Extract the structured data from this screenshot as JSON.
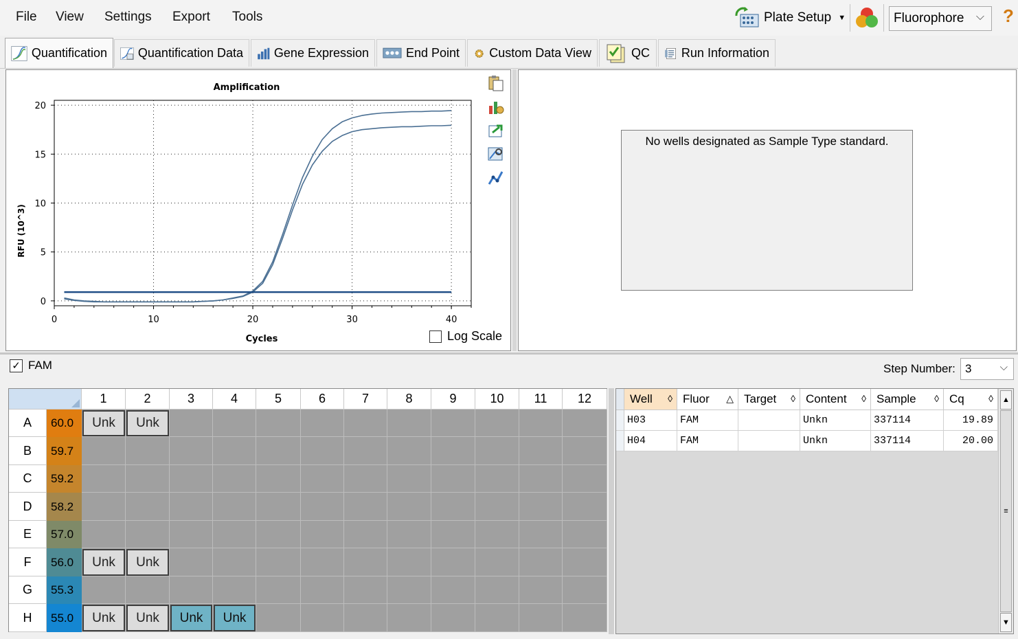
{
  "menu": {
    "items": [
      "File",
      "View",
      "Settings",
      "Export",
      "Tools"
    ]
  },
  "toolbar": {
    "plate_setup_label": "Plate Setup",
    "fluorophore_select": "Fluorophore",
    "help_label": "?"
  },
  "tabs": [
    {
      "label": "Quantification",
      "icon": "amplification-chart-icon",
      "active": true
    },
    {
      "label": "Quantification Data",
      "icon": "quantification-data-icon"
    },
    {
      "label": "Gene Expression",
      "icon": "bar-chart-icon"
    },
    {
      "label": "End Point",
      "icon": "end-point-icon"
    },
    {
      "label": "Custom Data View",
      "icon": "gear-icon"
    },
    {
      "label": "QC",
      "icon": "qc-checklist-icon"
    },
    {
      "label": "Run Information",
      "icon": "run-information-icon"
    }
  ],
  "chart": {
    "title": "Amplification",
    "xlabel": "Cycles",
    "ylabel": "RFU (10^3)",
    "log_scale_label": "Log Scale",
    "log_scale_checked": false
  },
  "chart_data": {
    "type": "line",
    "title": "Amplification",
    "xlabel": "Cycles",
    "ylabel": "RFU (10^3)",
    "xlim": [
      0,
      42
    ],
    "ylim": [
      -0.5,
      20.5
    ],
    "xticks": [
      0,
      10,
      20,
      30,
      40
    ],
    "yticks": [
      0,
      5,
      10,
      15,
      20
    ],
    "grid": true,
    "series": [
      {
        "color": "#4a6f93",
        "x": [
          1,
          2,
          3,
          4,
          5,
          6,
          7,
          8,
          9,
          10,
          11,
          12,
          13,
          14,
          15,
          16,
          17,
          18,
          19,
          20,
          21,
          22,
          23,
          24,
          25,
          26,
          27,
          28,
          29,
          30,
          31,
          32,
          33,
          34,
          35,
          36,
          37,
          38,
          39,
          40
        ],
        "y": [
          0.3,
          0.1,
          0.0,
          -0.05,
          -0.1,
          -0.1,
          -0.1,
          -0.1,
          -0.1,
          -0.1,
          -0.1,
          -0.1,
          -0.1,
          -0.1,
          -0.05,
          0.0,
          0.1,
          0.3,
          0.5,
          1.0,
          2.0,
          4.0,
          6.8,
          9.8,
          12.6,
          14.8,
          16.5,
          17.6,
          18.3,
          18.7,
          18.95,
          19.1,
          19.2,
          19.25,
          19.3,
          19.35,
          19.35,
          19.4,
          19.4,
          19.45
        ]
      },
      {
        "color": "#4a6f93",
        "x": [
          1,
          2,
          3,
          4,
          5,
          6,
          7,
          8,
          9,
          10,
          11,
          12,
          13,
          14,
          15,
          16,
          17,
          18,
          19,
          20,
          21,
          22,
          23,
          24,
          25,
          26,
          27,
          28,
          29,
          30,
          31,
          32,
          33,
          34,
          35,
          36,
          37,
          38,
          39,
          40
        ],
        "y": [
          0.2,
          0.05,
          -0.05,
          -0.1,
          -0.1,
          -0.1,
          -0.1,
          -0.1,
          -0.1,
          -0.1,
          -0.1,
          -0.1,
          -0.1,
          -0.1,
          -0.05,
          0.0,
          0.1,
          0.25,
          0.45,
          0.9,
          1.8,
          3.7,
          6.4,
          9.3,
          11.9,
          13.9,
          15.3,
          16.3,
          16.9,
          17.3,
          17.5,
          17.6,
          17.7,
          17.75,
          17.8,
          17.8,
          17.85,
          17.9,
          17.9,
          17.95
        ]
      },
      {
        "color": "#1f4e86",
        "x": [
          1,
          40
        ],
        "y": [
          0.9,
          0.9
        ]
      }
    ]
  },
  "right_panel": {
    "message": "No wells designated as Sample Type standard."
  },
  "filter": {
    "fam_label": "FAM",
    "fam_checked": true,
    "step_label": "Step Number:",
    "step_value": "3"
  },
  "plate": {
    "columns": [
      "1",
      "2",
      "3",
      "4",
      "5",
      "6",
      "7",
      "8",
      "9",
      "10",
      "11",
      "12"
    ],
    "rows": [
      {
        "label": "A",
        "temp": "60.0",
        "color": "#e07d10"
      },
      {
        "label": "B",
        "temp": "59.7",
        "color": "#d48218"
      },
      {
        "label": "C",
        "temp": "59.2",
        "color": "#c5852c"
      },
      {
        "label": "D",
        "temp": "58.2",
        "color": "#a5874c"
      },
      {
        "label": "E",
        "temp": "57.0",
        "color": "#7f8a68"
      },
      {
        "label": "F",
        "temp": "56.0",
        "color": "#4f8b94"
      },
      {
        "label": "G",
        "temp": "55.3",
        "color": "#2b88b5"
      },
      {
        "label": "H",
        "temp": "55.0",
        "color": "#1486d2"
      }
    ],
    "wells": [
      {
        "row": 0,
        "col": 0,
        "label": "Unk"
      },
      {
        "row": 0,
        "col": 1,
        "label": "Unk"
      },
      {
        "row": 5,
        "col": 0,
        "label": "Unk"
      },
      {
        "row": 5,
        "col": 1,
        "label": "Unk"
      },
      {
        "row": 7,
        "col": 0,
        "label": "Unk"
      },
      {
        "row": 7,
        "col": 1,
        "label": "Unk"
      },
      {
        "row": 7,
        "col": 2,
        "label": "Unk",
        "selected": true
      },
      {
        "row": 7,
        "col": 3,
        "label": "Unk",
        "selected": true
      }
    ]
  },
  "table": {
    "headers": [
      "Well",
      "Fluor",
      "Target",
      "Content",
      "Sample",
      "Cq"
    ],
    "sort_glyphs": [
      "◊",
      "△",
      "◊",
      "◊",
      "◊",
      "◊"
    ],
    "rows": [
      [
        "H03",
        "FAM",
        "",
        "Unkn",
        "337114",
        "19.89"
      ],
      [
        "H04",
        "FAM",
        "",
        "Unkn",
        "337114",
        "20.00"
      ]
    ]
  }
}
